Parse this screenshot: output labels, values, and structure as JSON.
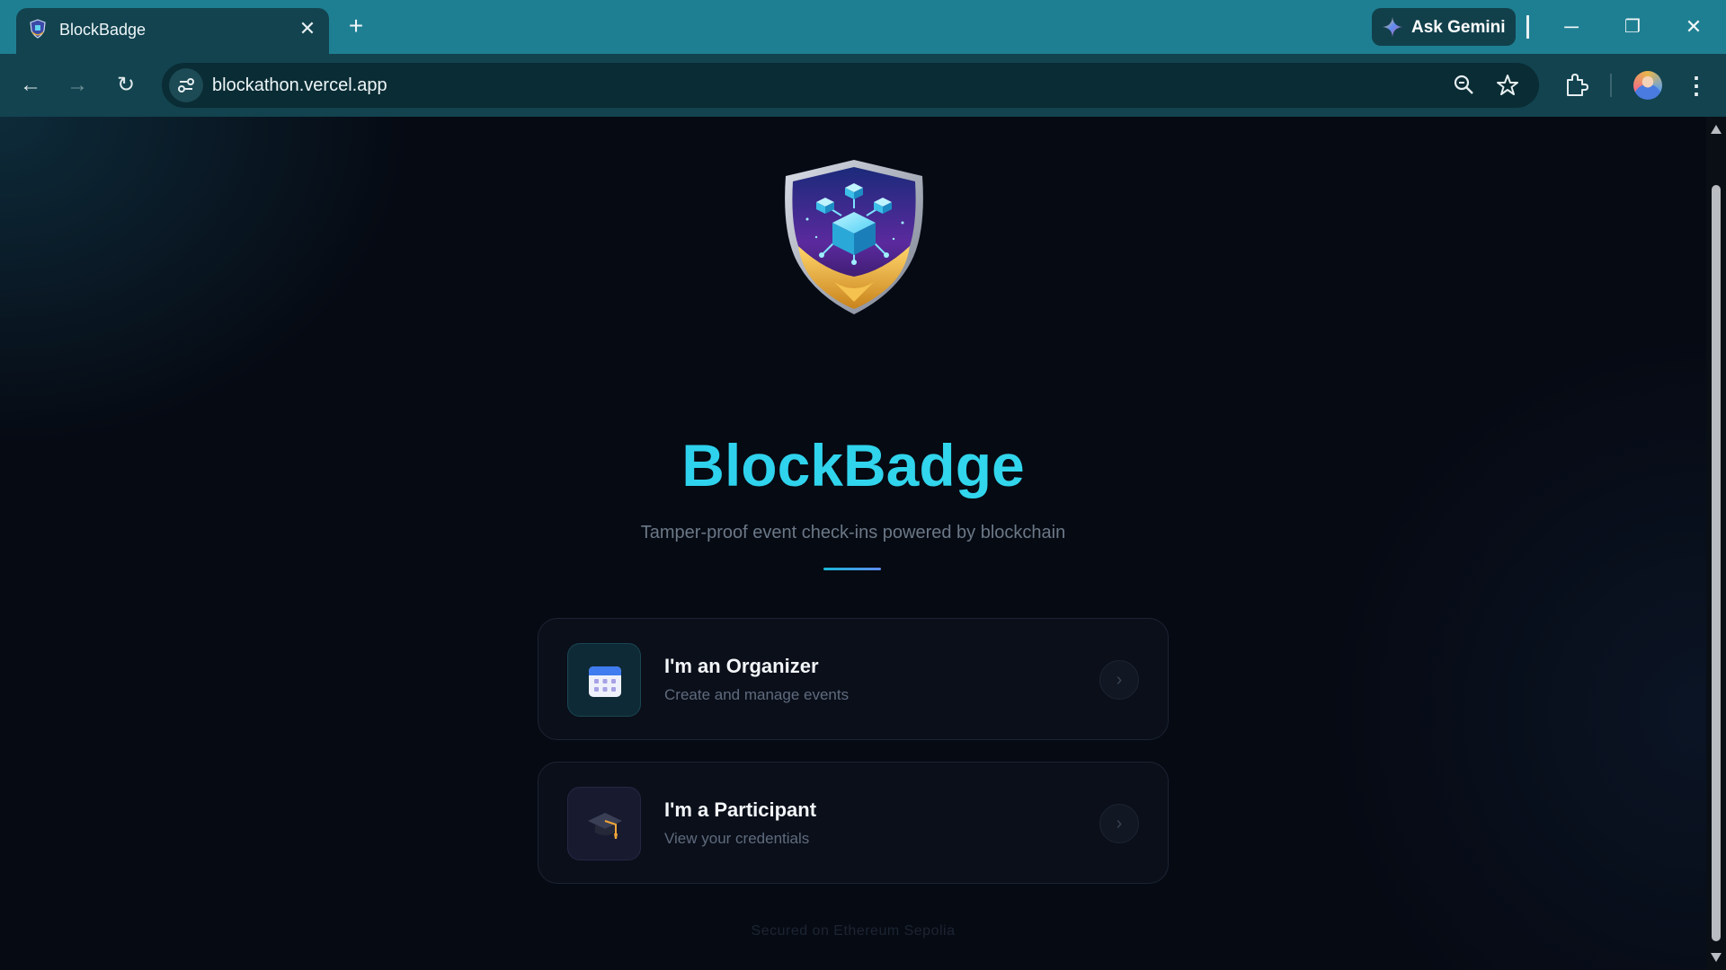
{
  "browser": {
    "tab": {
      "title": "BlockBadge",
      "close": "✕"
    },
    "new_tab": "+",
    "gemini_label": "Ask Gemini",
    "window": {
      "minimize": "─",
      "restore": "❐",
      "close": "✕"
    },
    "nav": {
      "back": "←",
      "forward": "→",
      "reload": "↻"
    },
    "url": "blockathon.vercel.app",
    "menu": "⋮"
  },
  "page": {
    "title": "BlockBadge",
    "tagline": "Tamper-proof event check-ins powered by blockchain",
    "roles": [
      {
        "title": "I'm an Organizer",
        "subtitle": "Create and manage events",
        "icon": "calendar-icon",
        "chevron": "›"
      },
      {
        "title": "I'm a Participant",
        "subtitle": "View your credentials",
        "icon": "graduation-cap-icon",
        "chevron": "›"
      }
    ],
    "footer": "Secured on Ethereum Sepolia"
  },
  "colors": {
    "titlebar": "#1f7f92",
    "toolbar": "#12434f",
    "brand_title": "#2fd1ec",
    "background": "#060a13"
  }
}
